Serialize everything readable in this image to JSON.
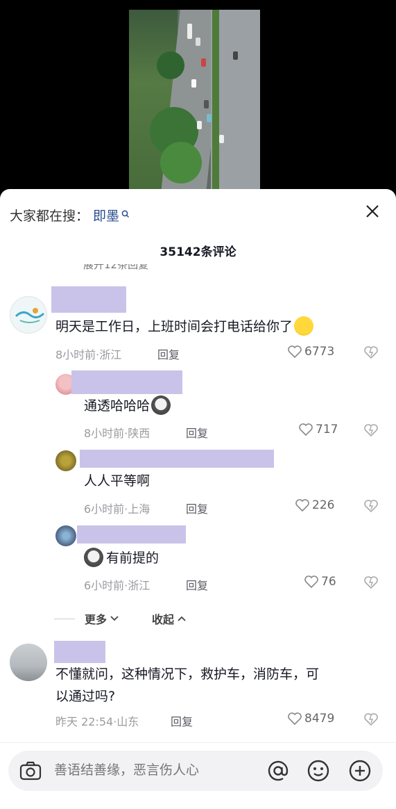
{
  "search": {
    "prefix": "大家都在搜：",
    "term": "即墨"
  },
  "comments_header": {
    "count_title": "35142条评论"
  },
  "expand_residue": "展开12条回复",
  "comments": [
    {
      "text": "明天是工作日，上班时间会打电话给你了",
      "meta": "8小时前·浙江",
      "reply_label": "回复",
      "likes": "6773"
    },
    {
      "text": "不懂就问，这种情况下，救护车，消防车，可以通过吗?",
      "text_line1": "不懂就问，这种情况下，救护车，消防车，可",
      "text_line2": "以通过吗?",
      "meta": "昨天 22:54·山东",
      "reply_label": "回复",
      "likes": "8479"
    }
  ],
  "replies": [
    {
      "text": "通透哈哈哈",
      "meta": "8小时前·陕西",
      "reply_label": "回复",
      "likes": "717"
    },
    {
      "text": "人人平等啊",
      "meta": "6小时前·上海",
      "reply_label": "回复",
      "likes": "226"
    },
    {
      "text": "有前提的",
      "meta": "6小时前·浙江",
      "reply_label": "回复",
      "likes": "76"
    }
  ],
  "thread_controls": {
    "more": "更多",
    "collapse": "收起"
  },
  "input": {
    "placeholder": "善语结善缘，恶言伤人心"
  },
  "colors": {
    "name_mask": "#c9c3ea",
    "search_term": "#2a4d8f"
  }
}
